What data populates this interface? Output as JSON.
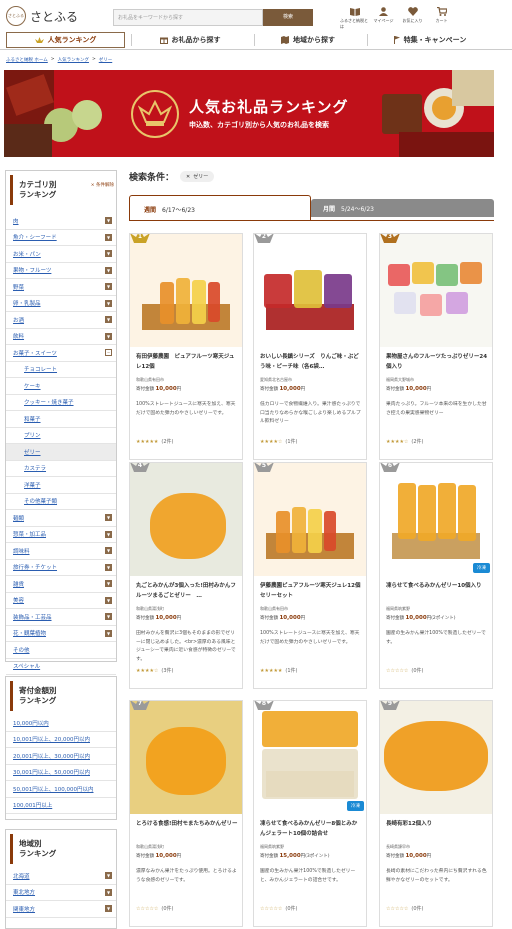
{
  "header": {
    "logo_sub": "さとふる",
    "logo_text": "さとふる",
    "search_placeholder": "お礼品をキーワードから探す",
    "search_button": "検索",
    "icons": [
      {
        "label": "ふるさと納税とは",
        "icon": "book-icon"
      },
      {
        "label": "マイページ",
        "icon": "user-icon"
      },
      {
        "label": "お気に入り",
        "icon": "heart-icon"
      },
      {
        "label": "カート",
        "icon": "cart-icon"
      }
    ]
  },
  "nav": {
    "ranking": "人気ランキング",
    "gifts": "お礼品から探す",
    "area": "地域から探す",
    "special": "特集・キャンペーン"
  },
  "breadcrumb": [
    "ふるさと納税 ホーム",
    "人気ランキング",
    "ゼリー"
  ],
  "banner": {
    "title": "人気お礼品ランキング",
    "subtitle": "申込数、カテゴリ別から人気のお礼品を検索"
  },
  "sidebar": {
    "category_title": "カテゴリ別\nランキング",
    "reset": "× 条件解除",
    "categories": [
      {
        "label": "肉",
        "type": "top"
      },
      {
        "label": "魚介・シーフード",
        "type": "top"
      },
      {
        "label": "お米・パン",
        "type": "top"
      },
      {
        "label": "果物・フルーツ",
        "type": "top"
      },
      {
        "label": "野菜",
        "type": "top"
      },
      {
        "label": "卵・乳製品",
        "type": "top"
      },
      {
        "label": "お酒",
        "type": "top"
      },
      {
        "label": "飲料",
        "type": "top"
      },
      {
        "label": "お菓子・スイーツ",
        "type": "open"
      },
      {
        "label": "チョコレート",
        "type": "sub"
      },
      {
        "label": "ケーキ",
        "type": "sub"
      },
      {
        "label": "クッキー・焼き菓子",
        "type": "sub"
      },
      {
        "label": "和菓子",
        "type": "sub"
      },
      {
        "label": "プリン",
        "type": "sub"
      },
      {
        "label": "ゼリー",
        "type": "sel"
      },
      {
        "label": "カステラ",
        "type": "sub"
      },
      {
        "label": "洋菓子",
        "type": "sub"
      },
      {
        "label": "その他菓子類",
        "type": "sub"
      },
      {
        "label": "麺類",
        "type": "top"
      },
      {
        "label": "惣菜・加工品",
        "type": "top"
      },
      {
        "label": "調味料",
        "type": "top"
      },
      {
        "label": "旅行券・チケット",
        "type": "top"
      },
      {
        "label": "雑貨",
        "type": "top"
      },
      {
        "label": "美容",
        "type": "top"
      },
      {
        "label": "装飾品・工芸品",
        "type": "top"
      },
      {
        "label": "花・観葉植物",
        "type": "top"
      },
      {
        "label": "その他",
        "type": "none"
      },
      {
        "label": "スペシャル",
        "type": "none"
      }
    ],
    "donation_title": "寄付金額別\nランキング",
    "donations": [
      "10,000円以内",
      "10,001円以上、20,000円以内",
      "20,001円以上、30,000円以内",
      "30,001円以上、50,000円以内",
      "50,001円以上、100,000円以内",
      "100,001円以上"
    ],
    "area_title": "地域別\nランキング",
    "areas": [
      "北海道",
      "東北地方",
      "関東地方"
    ]
  },
  "main": {
    "condition_label": "検索条件：",
    "chip": "ゼリー",
    "tab_weekly": "週間",
    "tab_weekly_range": "6/17〜6/23",
    "tab_monthly": "月間",
    "tab_monthly_range": "5/24〜6/23",
    "price_label": "寄付金額",
    "price_unit": "円",
    "products": [
      {
        "rank": "1",
        "title": "有田伊藤農園　ピュアフルーツ寒天ジュレ12個",
        "shop": "和歌山県有田市",
        "price": "10,000",
        "desc": "100%ストレートジュースに寒天を加え、寒天だけで固めた弾力のやさしいゼリーです。",
        "stars": "★★★★★",
        "count": "(2件)",
        "cold": ""
      },
      {
        "rank": "2",
        "title": "おいしい長鎮シリーズ　りんご味・ぶどう味・ピーチ味（各6袋…",
        "shop": "愛知県北名古屋市",
        "price": "10,000",
        "desc": "低カロリーで食物繊維入り。果汁感たっぷりで口当たりなめらかな喉ごしより楽しめるプルプル飲料ゼリー",
        "stars": "★★★★☆",
        "count": "(1件)",
        "cold": ""
      },
      {
        "rank": "3",
        "title": "果物屋さんのフルーツたっぷりゼリー24個入り",
        "shop": "福岡県大野城市",
        "price": "10,000",
        "desc": "果肉たっぷり。フルーツ本来の味を生かした甘さ控えの果実感果物ゼリー",
        "stars": "★★★★☆",
        "count": "(2件)",
        "cold": ""
      },
      {
        "rank": "4",
        "title": "丸ごとみかんが3個入った!田村みかんフルーツまるごとゼリー　…",
        "shop": "和歌山県湯浅町",
        "price": "10,000",
        "desc": "田村みかんを贅沢に3個もそのままの形でゼリーに閉じ込めました。<br>濃厚のある風味とジューシーで果肉に近い食感が特徴のゼリーです。",
        "stars": "★★★★☆",
        "count": "(3件)",
        "cold": ""
      },
      {
        "rank": "5",
        "title": "伊藤農園ピュアフルーツ寒天ジュレ12個セリーセット",
        "shop": "和歌山県有田市",
        "price": "10,000",
        "desc": "100%ストレートジュースに寒天を加え、寒天だけで固めた弾力のやさしいゼリーです。",
        "stars": "★★★★★",
        "count": "(1件)",
        "cold": ""
      },
      {
        "rank": "6",
        "title": "凍らせて食べるみかんゼリー10個入り",
        "shop": "福岡県筑紫野",
        "price": "10,000",
        "desc": "園産の生みかん果汁100%で製造したゼリーです。",
        "stars": "☆☆☆☆☆",
        "count": "(0件)",
        "cold": "冷凍",
        "points": "(2ポイント)"
      },
      {
        "rank": "7",
        "title": "とろける食感!田村モまたちみかんゼリー",
        "shop": "和歌山県湯浅町",
        "price": "10,000",
        "desc": "濃厚なみかん果汁をたっぷり使用。とろけるような食感のゼリーです。",
        "stars": "☆☆☆☆☆",
        "count": "(0件)",
        "cold": ""
      },
      {
        "rank": "8",
        "title": "凍らせて食べるみかんゼリー8個とみかんジェラート10個の詰合せ",
        "shop": "福岡県筑紫野",
        "price": "15,000",
        "desc": "園産の生みかん果汁100%で製造したゼリーと、みかんジェラートの詰合せです。",
        "stars": "☆☆☆☆☆",
        "count": "(0件)",
        "cold": "冷凍",
        "points": "(3ポイント)"
      },
      {
        "rank": "9",
        "title": "長崎有彩12個入り",
        "shop": "長崎県諫早市",
        "price": "10,000",
        "desc": "長崎の素材にこだわった県内にち贅沢すれる色鮮やかなゼリーのセットです。",
        "stars": "☆☆☆☆☆",
        "count": "(0件)",
        "cold": ""
      }
    ]
  },
  "colors": {
    "brand": "#8a3a0a",
    "banner": "#c0111a",
    "link": "#2a5db0",
    "gold": "#c9a227",
    "silver": "#9a9a9a",
    "bronze": "#b0701f"
  }
}
